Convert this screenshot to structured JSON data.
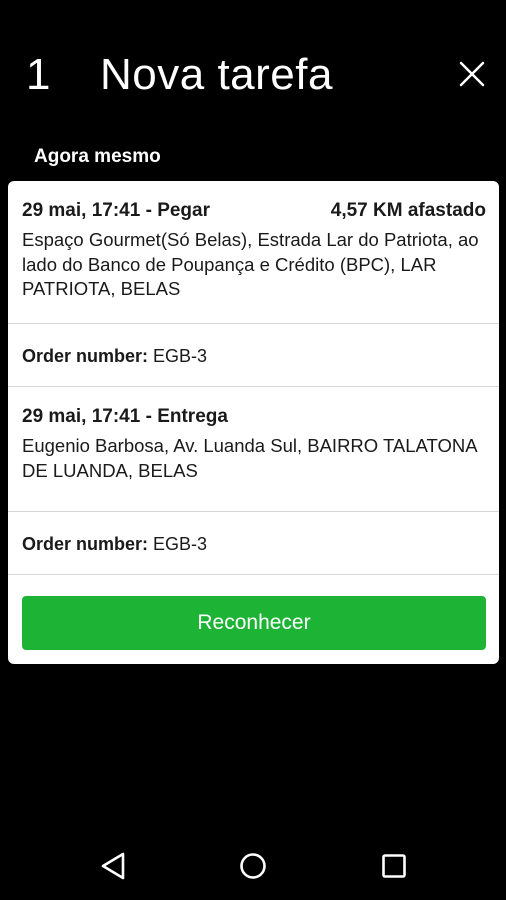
{
  "header": {
    "count": "1",
    "title": "Nova tarefa",
    "close_icon": "close-icon"
  },
  "subtitle": "Agora mesmo",
  "pickup": {
    "time_label": "29 mai, 17:41 - Pegar",
    "distance": "4,57 KM afastado",
    "address": "Espaço Gourmet(Só Belas), Estrada Lar do Patriota, ao lado do Banco de Poupança e Crédito (BPC), LAR PATRIOTA, BELAS",
    "order_label": "Order number:",
    "order_value": "EGB-3"
  },
  "dropoff": {
    "time_label": "29 mai, 17:41 - Entrega",
    "address": "Eugenio Barbosa, Av. Luanda Sul, BAIRRO TALATONA DE LUANDA, BELAS",
    "order_label": "Order number:",
    "order_value": "EGB-3"
  },
  "actions": {
    "acknowledge_label": "Reconhecer"
  },
  "navbar": {
    "back_icon": "back-triangle-icon",
    "home_icon": "home-circle-icon",
    "recent_icon": "recent-apps-square-icon"
  },
  "colors": {
    "background": "#000000",
    "card": "#ffffff",
    "accent_button": "#1db436"
  }
}
